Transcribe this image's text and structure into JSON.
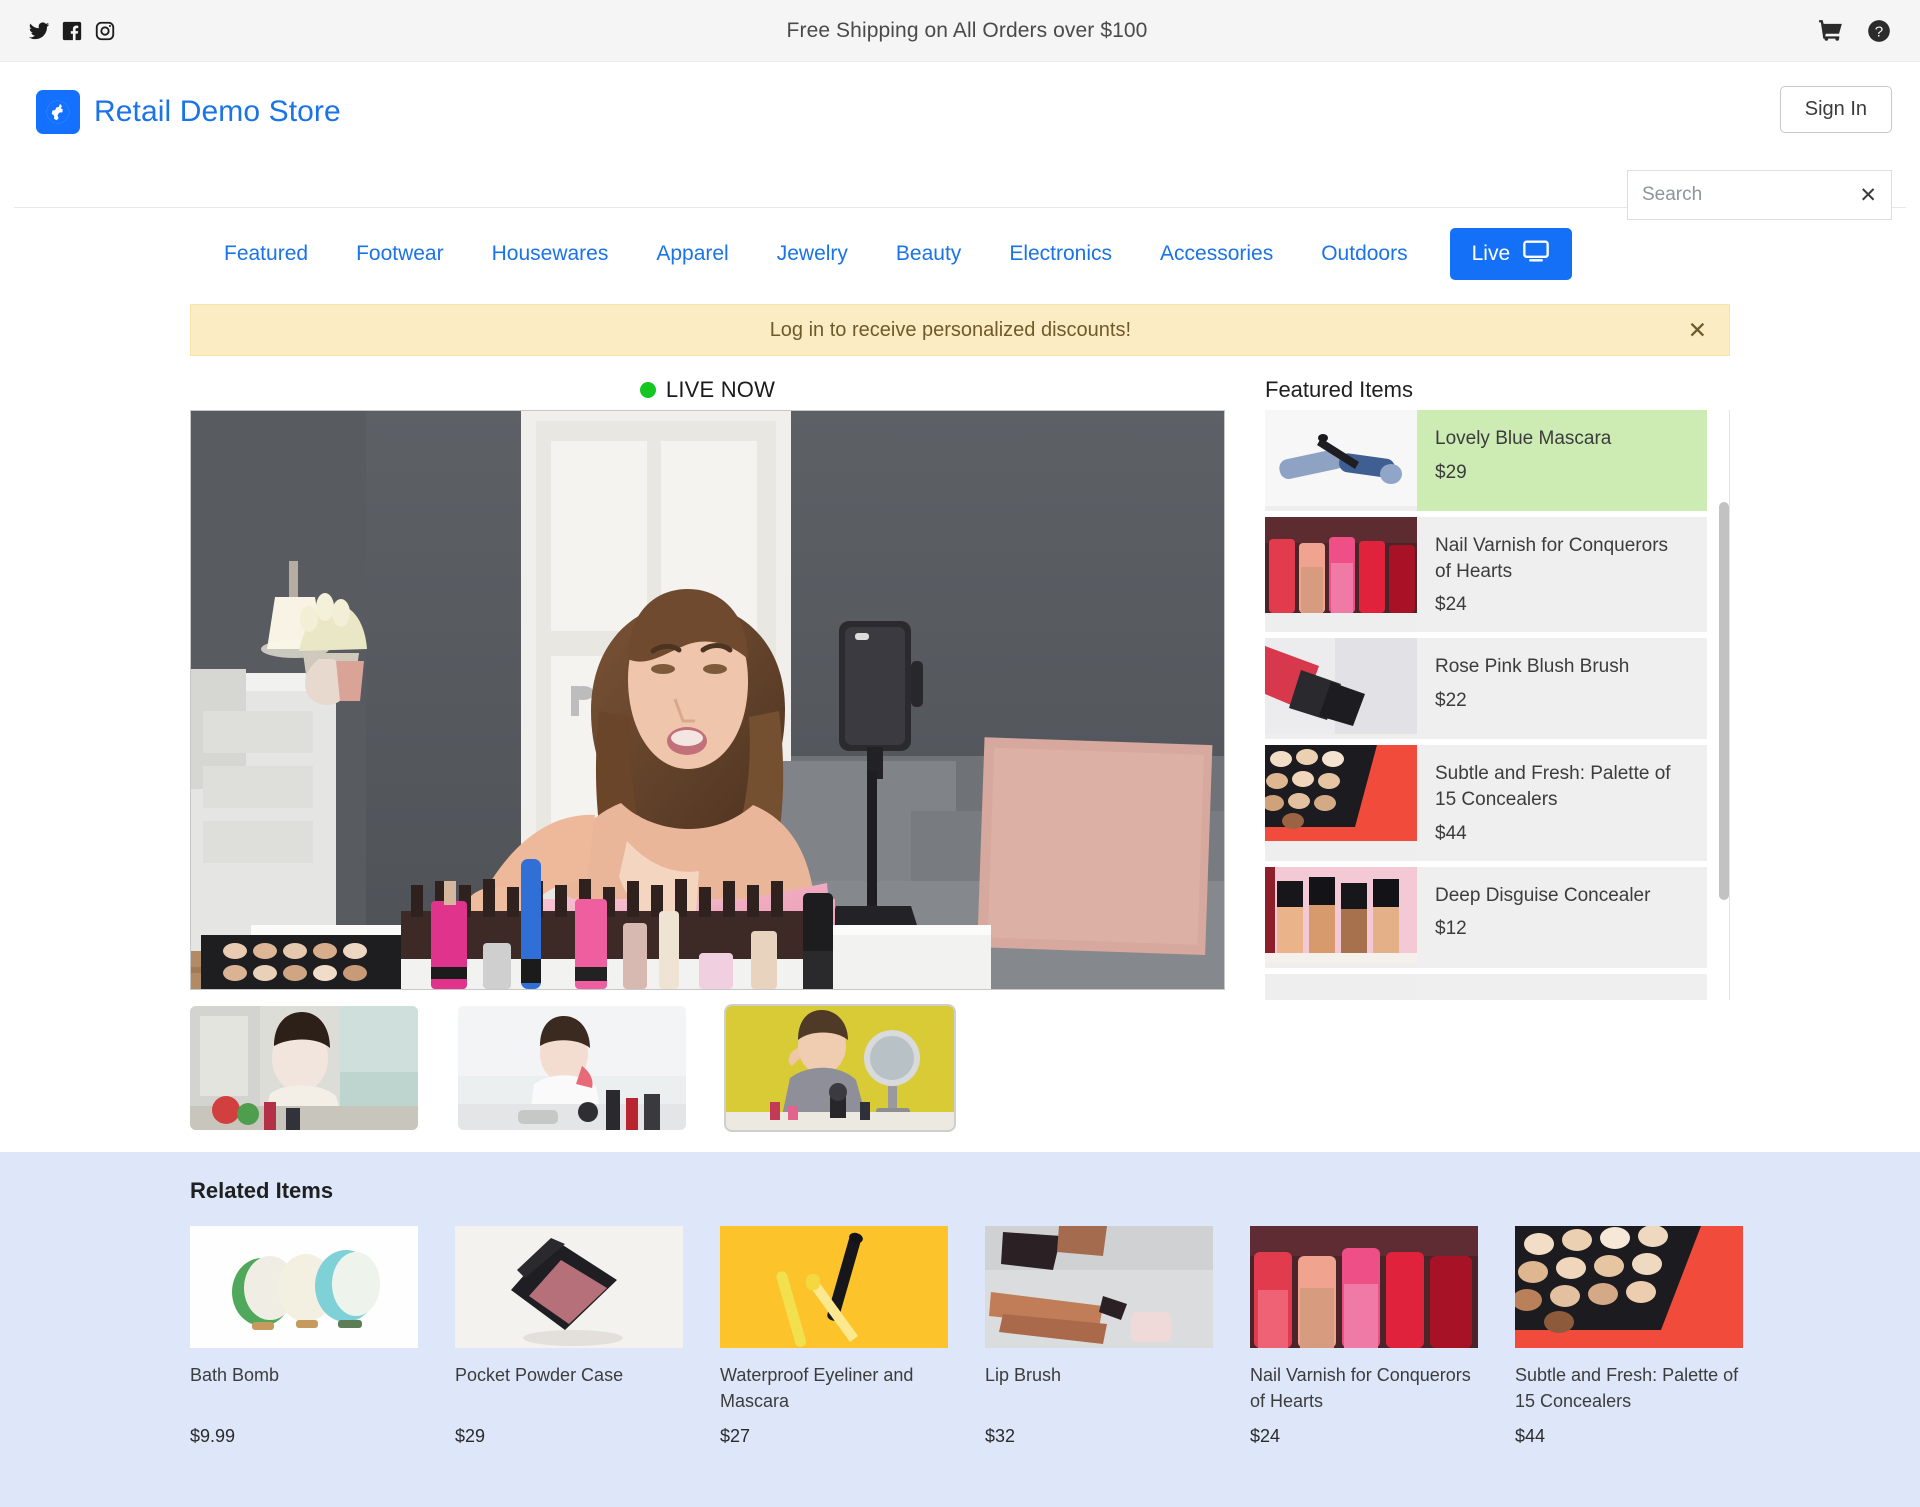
{
  "announcement": {
    "text": "Free Shipping on All Orders over $100",
    "social_icons": [
      "twitter-icon",
      "facebook-icon",
      "instagram-icon"
    ],
    "right_icons": [
      "shopping-cart-icon",
      "help-circle-icon"
    ]
  },
  "brand": {
    "name": "Retail Demo Store",
    "logo_icon": "globe-icon"
  },
  "account": {
    "sign_in_label": "Sign In"
  },
  "search": {
    "value": "",
    "placeholder": "Search",
    "clear_icon": "close-icon"
  },
  "nav": {
    "items": [
      {
        "label": "Featured"
      },
      {
        "label": "Footwear"
      },
      {
        "label": "Housewares"
      },
      {
        "label": "Apparel"
      },
      {
        "label": "Jewelry"
      },
      {
        "label": "Beauty"
      },
      {
        "label": "Electronics"
      },
      {
        "label": "Accessories"
      },
      {
        "label": "Outdoors"
      }
    ],
    "live_button": {
      "label": "Live",
      "icon": "tv-monitor-icon",
      "color": "#1471f7"
    }
  },
  "alert": {
    "message": "Log in to receive personalized discounts!",
    "close_icon": "close-icon",
    "background": "#fcecc4"
  },
  "live": {
    "status_label": "LIVE NOW",
    "status_color": "#16c622",
    "thumbnails": [
      {
        "name": "video-thumbnail-1",
        "selected": false
      },
      {
        "name": "video-thumbnail-2",
        "selected": false
      },
      {
        "name": "video-thumbnail-3",
        "selected": true
      }
    ]
  },
  "featured": {
    "title": "Featured Items",
    "highlight_color": "#cdecb4",
    "items": [
      {
        "name": "Lovely Blue Mascara",
        "price": "$29",
        "highlighted": true
      },
      {
        "name": "Nail Varnish for Conquerors of Hearts",
        "price": "$24",
        "highlighted": false
      },
      {
        "name": "Rose Pink Blush Brush",
        "price": "$22",
        "highlighted": false
      },
      {
        "name": "Subtle and Fresh: Palette of 15 Concealers",
        "price": "$44",
        "highlighted": false
      },
      {
        "name": "Deep Disguise Concealer",
        "price": "$12",
        "highlighted": false
      }
    ]
  },
  "related": {
    "title": "Related Items",
    "background": "#dde7f9",
    "items": [
      {
        "name": "Bath Bomb",
        "price": "$9.99"
      },
      {
        "name": "Pocket Powder Case",
        "price": "$29"
      },
      {
        "name": "Waterproof Eyeliner and Mascara",
        "price": "$27"
      },
      {
        "name": "Lip Brush",
        "price": "$32"
      },
      {
        "name": "Nail Varnish for Conquerors of Hearts",
        "price": "$24"
      },
      {
        "name": "Subtle and Fresh: Palette of 15 Concealers",
        "price": "$44"
      }
    ]
  }
}
